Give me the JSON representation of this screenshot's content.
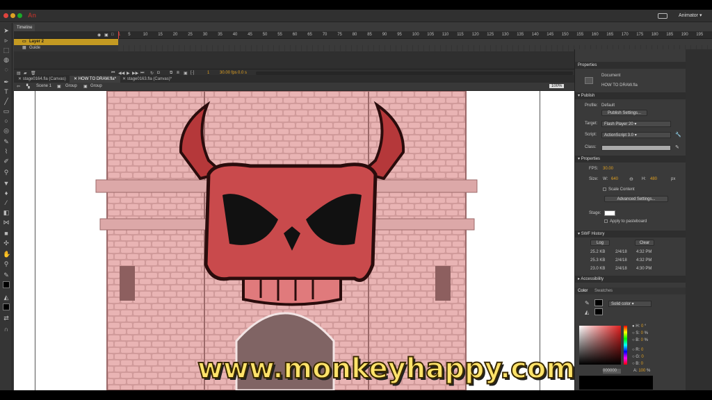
{
  "app": {
    "logo": "An",
    "workspace_label": "Animator",
    "colors": {
      "accent": "#e0a020",
      "layer_active": "#c49a22",
      "logo": "#a0332d"
    }
  },
  "timeline": {
    "tab_label": "Timeline",
    "frame_numbers": [
      "1",
      "5",
      "10",
      "15",
      "20",
      "25",
      "30",
      "35",
      "40",
      "45",
      "50",
      "55",
      "60",
      "65",
      "70",
      "75",
      "80",
      "85",
      "90",
      "95",
      "100",
      "105",
      "110",
      "115",
      "120",
      "125",
      "130",
      "135",
      "140",
      "145",
      "150",
      "155",
      "160",
      "165",
      "170",
      "175",
      "180",
      "185",
      "190",
      "195"
    ],
    "layers": [
      {
        "name": "Layer 2",
        "active": true
      },
      {
        "name": "Guide",
        "active": false
      }
    ],
    "current_frame": "1",
    "fps_display": "30.00 fps",
    "time_display": "0.0 s"
  },
  "documents": {
    "tabs": [
      {
        "label": "stage0164.fla (Canvas)",
        "active": false
      },
      {
        "label": "HOW TO DRAW.fla*",
        "active": true
      },
      {
        "label": "stage0163.fla (Canvas)*",
        "active": false
      }
    ],
    "breadcrumbs": [
      "Scene 1",
      "Group",
      "Group"
    ],
    "zoom": "100%"
  },
  "watermark": "www.monkeyhappy.com",
  "properties": {
    "title": "Properties",
    "doc_type": "Document",
    "doc_name": "HOW TO DRAW.fla",
    "publish": {
      "header": "Publish",
      "profile_label": "Profile:",
      "profile_value": "Default",
      "settings_button": "Publish Settings...",
      "target_label": "Target:",
      "target_value": "Flash Player 20",
      "script_label": "Script:",
      "script_value": "ActionScript 3.0",
      "class_label": "Class:"
    },
    "props": {
      "header": "Properties",
      "fps_label": "FPS:",
      "fps_value": "30.00",
      "size_label": "Size:",
      "w_label": "W:",
      "w_value": "640",
      "h_label": "H:",
      "h_value": "480",
      "unit": "px",
      "scale_content": "Scale Content",
      "advanced_button": "Advanced Settings...",
      "stage_label": "Stage:",
      "apply_pasteboard": "Apply to pasteboard"
    },
    "swf_history": {
      "header": "SWF History",
      "log_button": "Log",
      "clear_button": "Clear",
      "rows": [
        {
          "size": "25.2 KB",
          "date": "2/4/18",
          "time": "4:32 PM"
        },
        {
          "size": "25.3 KB",
          "date": "2/4/18",
          "time": "4:32 PM"
        },
        {
          "size": "23.0 KB",
          "date": "2/4/18",
          "time": "4:30 PM"
        }
      ]
    },
    "accessibility_header": "Accessibility",
    "color": {
      "tab_color": "Color",
      "tab_swatches": "Swatches",
      "fill_type": "Solid color",
      "h_label": "H:",
      "h_value": "0",
      "s_label": "S:",
      "s_value": "0",
      "b_label": "B:",
      "b_value": "0",
      "r_label": "R:",
      "r_value": "0",
      "g_label": "G:",
      "g_value": "0",
      "b2_label": "B:",
      "b2_value": "0",
      "a_label": "A:",
      "a_value": "100",
      "hex_value": "000000"
    }
  }
}
